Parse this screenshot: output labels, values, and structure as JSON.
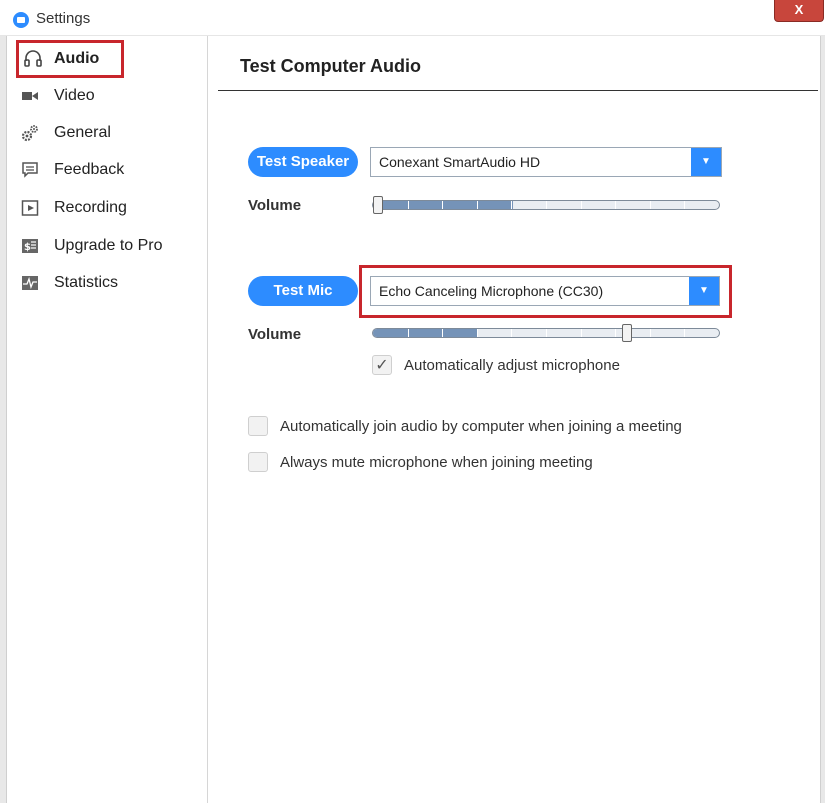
{
  "window": {
    "title": "Settings",
    "close_label": "X"
  },
  "sidebar": {
    "items": [
      {
        "label": "Audio",
        "icon": "headphones-icon",
        "active": true
      },
      {
        "label": "Video",
        "icon": "video-camera-icon",
        "active": false
      },
      {
        "label": "General",
        "icon": "gears-icon",
        "active": false
      },
      {
        "label": "Feedback",
        "icon": "feedback-icon",
        "active": false
      },
      {
        "label": "Recording",
        "icon": "recording-icon",
        "active": false
      },
      {
        "label": "Upgrade to Pro",
        "icon": "upgrade-icon",
        "active": false
      },
      {
        "label": "Statistics",
        "icon": "statistics-icon",
        "active": false
      }
    ]
  },
  "main": {
    "title": "Test Computer Audio",
    "speaker": {
      "button_label": "Test Speaker",
      "device": "Conexant SmartAudio HD",
      "volume_label": "Volume",
      "volume_level": 0.0
    },
    "mic": {
      "button_label": "Test Mic",
      "device": "Echo Canceling Microphone (CC30)",
      "volume_label": "Volume",
      "volume_level": 0.74,
      "auto_adjust_label": "Automatically adjust microphone",
      "auto_adjust_checked": true
    },
    "options": [
      {
        "label": "Automatically join audio by computer when joining a meeting",
        "checked": false
      },
      {
        "label": "Always mute microphone when joining meeting",
        "checked": false
      }
    ]
  },
  "colors": {
    "accent": "#2d8cff",
    "highlight": "#c8262c"
  }
}
